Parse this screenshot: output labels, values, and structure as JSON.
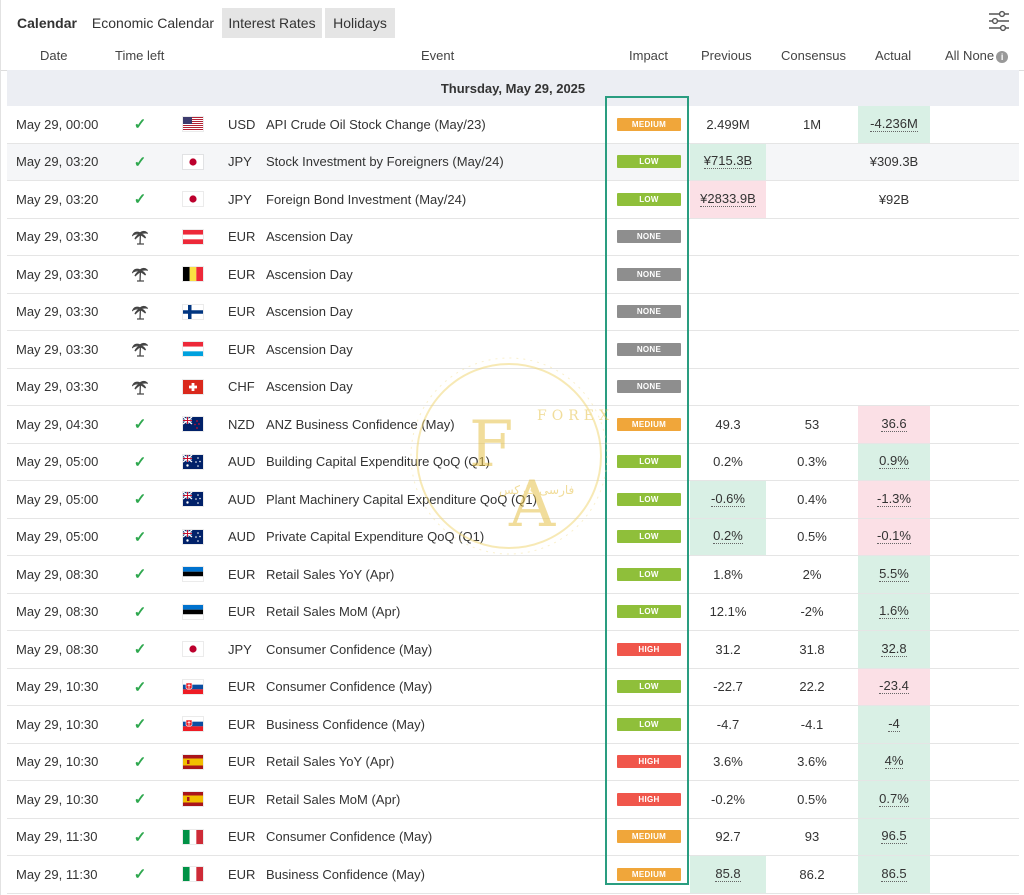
{
  "tabs": [
    {
      "label": "Calendar"
    },
    {
      "label": "Economic Calendar"
    },
    {
      "label": "Interest Rates"
    },
    {
      "label": "Holidays"
    }
  ],
  "columns": {
    "date": "Date",
    "time_left": "Time left",
    "event": "Event",
    "impact": "Impact",
    "previous": "Previous",
    "consensus": "Consensus",
    "actual": "Actual",
    "all_none": "All None"
  },
  "day_header": "Thursday, May 29, 2025",
  "colors": {
    "accent_box": "#2a9d80",
    "medium": "#f0a63a",
    "low": "#8fbf3a",
    "none": "#8e8e8e",
    "high": "#f0564b",
    "positive_bg": "#d9f0e5",
    "negative_bg": "#fbe0e6"
  },
  "watermark": {
    "top": "FOREX",
    "letter1": "F",
    "letter2": "A",
    "arabic": "فارسی فارکس"
  },
  "rows": [
    {
      "date": "May 29, 00:00",
      "status": "check",
      "flag": "us",
      "currency": "USD",
      "event": "API Crude Oil Stock Change (May/23)",
      "impact": "MEDIUM",
      "previous": "2.499M",
      "consensus": "1M",
      "actual": "-4.236M",
      "actual_tone": "green"
    },
    {
      "date": "May 29, 03:20",
      "status": "check",
      "flag": "jp",
      "currency": "JPY",
      "event": "Stock Investment by Foreigners (May/24)",
      "impact": "LOW",
      "previous": "¥715.3B",
      "previous_tone": "green",
      "consensus": "",
      "actual": "¥309.3B"
    },
    {
      "date": "May 29, 03:20",
      "status": "check",
      "flag": "jp",
      "currency": "JPY",
      "event": "Foreign Bond Investment (May/24)",
      "impact": "LOW",
      "previous": "¥2833.9B",
      "previous_tone": "red",
      "consensus": "",
      "actual": "¥92B"
    },
    {
      "date": "May 29, 03:30",
      "status": "holiday",
      "flag": "at",
      "currency": "EUR",
      "event": "Ascension Day",
      "impact": "NONE",
      "previous": "",
      "consensus": "",
      "actual": ""
    },
    {
      "date": "May 29, 03:30",
      "status": "holiday",
      "flag": "be",
      "currency": "EUR",
      "event": "Ascension Day",
      "impact": "NONE",
      "previous": "",
      "consensus": "",
      "actual": ""
    },
    {
      "date": "May 29, 03:30",
      "status": "holiday",
      "flag": "fi",
      "currency": "EUR",
      "event": "Ascension Day",
      "impact": "NONE",
      "previous": "",
      "consensus": "",
      "actual": ""
    },
    {
      "date": "May 29, 03:30",
      "status": "holiday",
      "flag": "lu",
      "currency": "EUR",
      "event": "Ascension Day",
      "impact": "NONE",
      "previous": "",
      "consensus": "",
      "actual": ""
    },
    {
      "date": "May 29, 03:30",
      "status": "holiday",
      "flag": "ch",
      "currency": "CHF",
      "event": "Ascension Day",
      "impact": "NONE",
      "previous": "",
      "consensus": "",
      "actual": ""
    },
    {
      "date": "May 29, 04:30",
      "status": "check",
      "flag": "nz",
      "currency": "NZD",
      "event": "ANZ Business Confidence (May)",
      "impact": "MEDIUM",
      "previous": "49.3",
      "consensus": "53",
      "actual": "36.6",
      "actual_tone": "red"
    },
    {
      "date": "May 29, 05:00",
      "status": "check",
      "flag": "au",
      "currency": "AUD",
      "event": "Building Capital Expenditure QoQ (Q1)",
      "impact": "LOW",
      "previous": "0.2%",
      "consensus": "0.3%",
      "actual": "0.9%",
      "actual_tone": "green"
    },
    {
      "date": "May 29, 05:00",
      "status": "check",
      "flag": "au",
      "currency": "AUD",
      "event": "Plant Machinery Capital Expenditure QoQ (Q1)",
      "impact": "LOW",
      "previous": "-0.6%",
      "previous_tone": "green",
      "consensus": "0.4%",
      "actual": "-1.3%",
      "actual_tone": "red"
    },
    {
      "date": "May 29, 05:00",
      "status": "check",
      "flag": "au",
      "currency": "AUD",
      "event": "Private Capital Expenditure QoQ (Q1)",
      "impact": "LOW",
      "previous": "0.2%",
      "previous_tone": "green",
      "consensus": "0.5%",
      "actual": "-0.1%",
      "actual_tone": "red"
    },
    {
      "date": "May 29, 08:30",
      "status": "check",
      "flag": "ee",
      "currency": "EUR",
      "event": "Retail Sales YoY (Apr)",
      "impact": "LOW",
      "previous": "1.8%",
      "consensus": "2%",
      "actual": "5.5%",
      "actual_tone": "green"
    },
    {
      "date": "May 29, 08:30",
      "status": "check",
      "flag": "ee",
      "currency": "EUR",
      "event": "Retail Sales MoM (Apr)",
      "impact": "LOW",
      "previous": "12.1%",
      "consensus": "-2%",
      "actual": "1.6%",
      "actual_tone": "green"
    },
    {
      "date": "May 29, 08:30",
      "status": "check",
      "flag": "jp",
      "currency": "JPY",
      "event": "Consumer Confidence (May)",
      "impact": "HIGH",
      "previous": "31.2",
      "consensus": "31.8",
      "actual": "32.8",
      "actual_tone": "green"
    },
    {
      "date": "May 29, 10:30",
      "status": "check",
      "flag": "sk",
      "currency": "EUR",
      "event": "Consumer Confidence (May)",
      "impact": "LOW",
      "previous": "-22.7",
      "consensus": "22.2",
      "actual": "-23.4",
      "actual_tone": "red"
    },
    {
      "date": "May 29, 10:30",
      "status": "check",
      "flag": "sk",
      "currency": "EUR",
      "event": "Business Confidence (May)",
      "impact": "LOW",
      "previous": "-4.7",
      "consensus": "-4.1",
      "actual": "-4",
      "actual_tone": "green"
    },
    {
      "date": "May 29, 10:30",
      "status": "check",
      "flag": "es",
      "currency": "EUR",
      "event": "Retail Sales YoY (Apr)",
      "impact": "HIGH",
      "previous": "3.6%",
      "consensus": "3.6%",
      "actual": "4%",
      "actual_tone": "green"
    },
    {
      "date": "May 29, 10:30",
      "status": "check",
      "flag": "es",
      "currency": "EUR",
      "event": "Retail Sales MoM (Apr)",
      "impact": "HIGH",
      "previous": "-0.2%",
      "consensus": "0.5%",
      "actual": "0.7%",
      "actual_tone": "green"
    },
    {
      "date": "May 29, 11:30",
      "status": "check",
      "flag": "it",
      "currency": "EUR",
      "event": "Consumer Confidence (May)",
      "impact": "MEDIUM",
      "previous": "92.7",
      "consensus": "93",
      "actual": "96.5",
      "actual_tone": "green"
    },
    {
      "date": "May 29, 11:30",
      "status": "check",
      "flag": "it",
      "currency": "EUR",
      "event": "Business Confidence (May)",
      "impact": "MEDIUM",
      "previous": "85.8",
      "previous_tone": "green",
      "consensus": "86.2",
      "actual": "86.5",
      "actual_tone": "green"
    }
  ]
}
